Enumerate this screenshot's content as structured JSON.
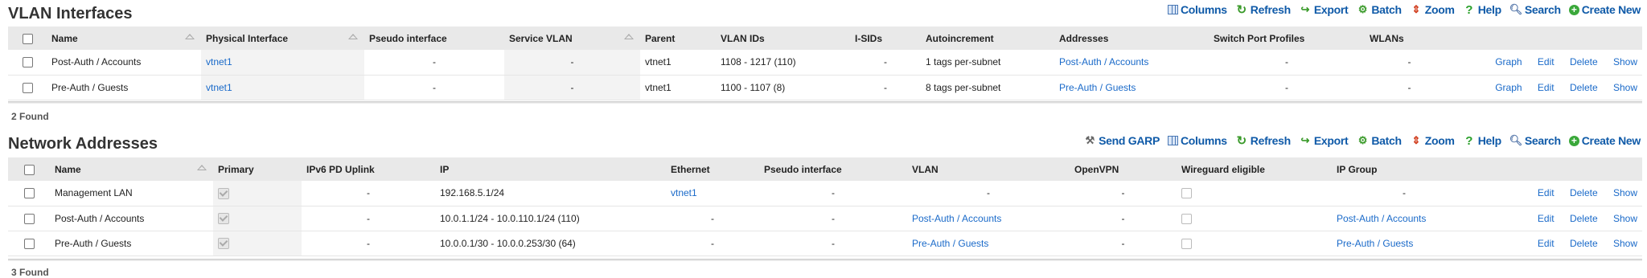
{
  "vlan": {
    "title": "VLAN Interfaces",
    "toolbar": [
      {
        "label": "Columns",
        "icon": "columns-icon"
      },
      {
        "label": "Refresh",
        "icon": "refresh-icon"
      },
      {
        "label": "Export",
        "icon": "export-icon"
      },
      {
        "label": "Batch",
        "icon": "batch-icon"
      },
      {
        "label": "Zoom",
        "icon": "zoom-icon"
      },
      {
        "label": "Help",
        "icon": "help-icon"
      },
      {
        "label": "Search",
        "icon": "search-icon"
      },
      {
        "label": "Create New",
        "icon": "create-new-icon"
      }
    ],
    "headers": [
      "Name",
      "Physical Interface",
      "Pseudo interface",
      "Service VLAN",
      "Parent",
      "VLAN IDs",
      "I-SIDs",
      "Autoincrement",
      "Addresses",
      "Switch Port Profiles",
      "WLANs"
    ],
    "rows": [
      {
        "name": "Post-Auth / Accounts",
        "physical": "vtnet1",
        "pseudo": "-",
        "service_vlan": "-",
        "parent": "vtnet1",
        "vlan_ids": "1108 - 1217 (110)",
        "isids": "-",
        "autoincrement": "1 tags per-subnet",
        "addresses": "Post-Auth / Accounts",
        "switch_port_profiles": "-",
        "wlans": "-"
      },
      {
        "name": "Pre-Auth / Guests",
        "physical": "vtnet1",
        "pseudo": "-",
        "service_vlan": "-",
        "parent": "vtnet1",
        "vlan_ids": "1100 - 1107 (8)",
        "isids": "-",
        "autoincrement": "8 tags per-subnet",
        "addresses": "Pre-Auth / Guests",
        "switch_port_profiles": "-",
        "wlans": "-"
      }
    ],
    "actions": [
      "Graph",
      "Edit",
      "Delete",
      "Show"
    ],
    "found": "2 Found"
  },
  "network": {
    "title": "Network Addresses",
    "toolbar": [
      {
        "label": "Send GARP",
        "icon": "send-garp-icon"
      },
      {
        "label": "Columns",
        "icon": "columns-icon"
      },
      {
        "label": "Refresh",
        "icon": "refresh-icon"
      },
      {
        "label": "Export",
        "icon": "export-icon"
      },
      {
        "label": "Batch",
        "icon": "batch-icon"
      },
      {
        "label": "Zoom",
        "icon": "zoom-icon"
      },
      {
        "label": "Help",
        "icon": "help-icon"
      },
      {
        "label": "Search",
        "icon": "search-icon"
      },
      {
        "label": "Create New",
        "icon": "create-new-icon"
      }
    ],
    "headers": [
      "Name",
      "Primary",
      "IPv6 PD Uplink",
      "IP",
      "Ethernet",
      "Pseudo interface",
      "VLAN",
      "OpenVPN",
      "Wireguard eligible",
      "IP Group"
    ],
    "rows": [
      {
        "name": "Management LAN",
        "primary": true,
        "ipv6": "-",
        "ip": "192.168.5.1/24",
        "ethernet": "vtnet1",
        "pseudo": "-",
        "vlan": "-",
        "openvpn": "-",
        "wireguard": false,
        "ip_group": "-"
      },
      {
        "name": "Post-Auth / Accounts",
        "primary": true,
        "ipv6": "-",
        "ip": "10.0.1.1/24 - 10.0.110.1/24 (110)",
        "ethernet": "-",
        "pseudo": "-",
        "vlan": "Post-Auth / Accounts",
        "openvpn": "-",
        "wireguard": false,
        "ip_group": "Post-Auth / Accounts"
      },
      {
        "name": "Pre-Auth / Guests",
        "primary": true,
        "ipv6": "-",
        "ip": "10.0.0.1/30 - 10.0.0.253/30 (64)",
        "ethernet": "-",
        "pseudo": "-",
        "vlan": "Pre-Auth / Guests",
        "openvpn": "-",
        "wireguard": false,
        "ip_group": "Pre-Auth / Guests"
      }
    ],
    "actions": [
      "Edit",
      "Delete",
      "Show"
    ],
    "found": "3 Found"
  }
}
